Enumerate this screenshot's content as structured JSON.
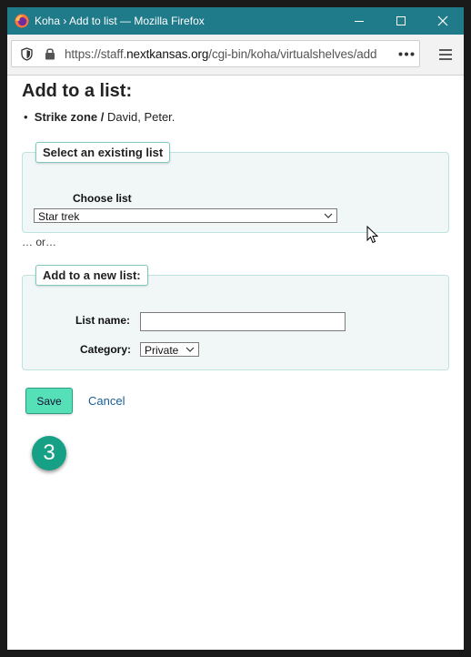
{
  "window": {
    "title": "Koha › Add to list — Mozilla Firefox",
    "controls": [
      "minimize",
      "maximize",
      "close"
    ]
  },
  "browser": {
    "url_prefix": "https://staff.",
    "url_domain": "nextkansas.org",
    "url_path": "/cgi-bin/koha/virtualshelves/add",
    "icons": [
      "shield-icon",
      "lock-icon",
      "more-icon",
      "menu-icon"
    ]
  },
  "page": {
    "heading": "Add to a list:",
    "item_title": "Strike zone /",
    "item_author": "David, Peter.",
    "existing_list": {
      "legend": "Select an existing list",
      "choose_label": "Choose list",
      "selected": "Star trek"
    },
    "or_text": "… or…",
    "new_list": {
      "legend": "Add to a new list:",
      "name_label": "List name:",
      "name_value": "",
      "category_label": "Category:",
      "category_selected": "Private"
    },
    "save_label": "Save",
    "cancel_label": "Cancel"
  },
  "overlay": {
    "step_number": "3",
    "accent_color": "#16a085"
  }
}
